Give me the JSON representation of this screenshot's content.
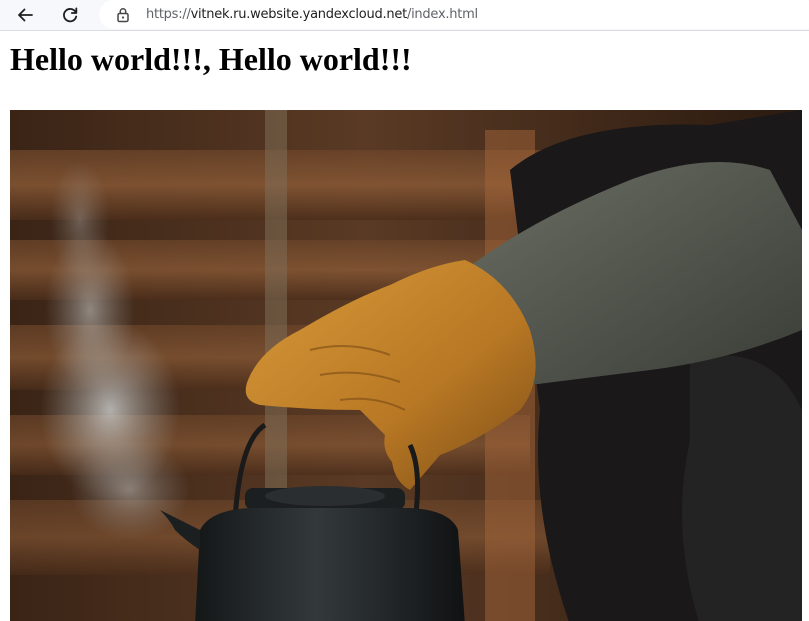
{
  "browser": {
    "back_icon": "arrow-left-icon",
    "reload_icon": "reload-icon",
    "lock_icon": "lock-icon",
    "url": {
      "scheme": "https://",
      "host": "vitnek.ru.website.yandexcloud.net",
      "path": "/index.html"
    }
  },
  "page": {
    "heading": "Hello world!!!, Hello world!!!",
    "image": {
      "subject": "gloved-hand-holding-kettle",
      "colors": {
        "background": "#4a2e1c",
        "glove": "#c6872a",
        "kettle": "#1e2224",
        "sleeve": "#55594f"
      }
    }
  }
}
